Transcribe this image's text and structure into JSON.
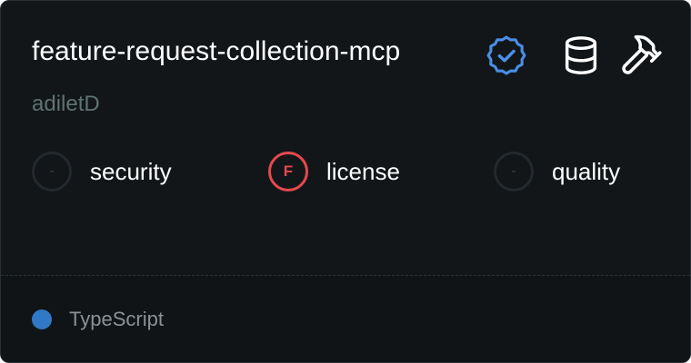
{
  "card": {
    "title": "feature-request-collection-mcp",
    "author": "adiletD",
    "icons": {
      "verified": "verified-badge-icon",
      "database": "database-icon",
      "tools": "hammer-icon"
    },
    "scores": [
      {
        "label": "security",
        "grade": "-"
      },
      {
        "label": "license",
        "grade": "F"
      },
      {
        "label": "quality",
        "grade": "-"
      }
    ],
    "language": {
      "name": "TypeScript",
      "color": "#3178c6"
    }
  },
  "colors": {
    "background": "#121619",
    "verified": "#4a8fe7",
    "fail": "#e5484d",
    "muted_text": "#5f7371"
  }
}
